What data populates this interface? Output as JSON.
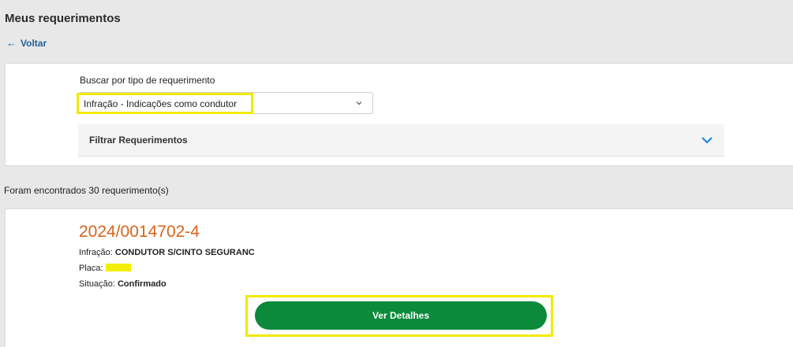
{
  "page": {
    "title": "Meus requerimentos",
    "back_label": "Voltar",
    "back_icon": "arrow-left-icon"
  },
  "filter": {
    "label": "Buscar por tipo de requerimento",
    "selected": "Infração - Indicações como condutor",
    "accordion_label": "Filtrar Requerimentos"
  },
  "results": {
    "count_text": "Foram encontrados 30 requerimento(s)"
  },
  "request": {
    "number": "2024/0014702-4",
    "infraction_label": "Infração:",
    "infraction_value": "CONDUTOR S/CINTO SEGURANC",
    "plate_label": "Placa:",
    "status_label": "Situação:",
    "status_value": "Confirmado",
    "details_button": "Ver Detalhes"
  },
  "colors": {
    "accent_link": "#1f5f9a",
    "request_number": "#d8641a",
    "primary_button": "#0a8a3a",
    "highlight": "#f2ea00",
    "chevron": "#1e88e5"
  }
}
